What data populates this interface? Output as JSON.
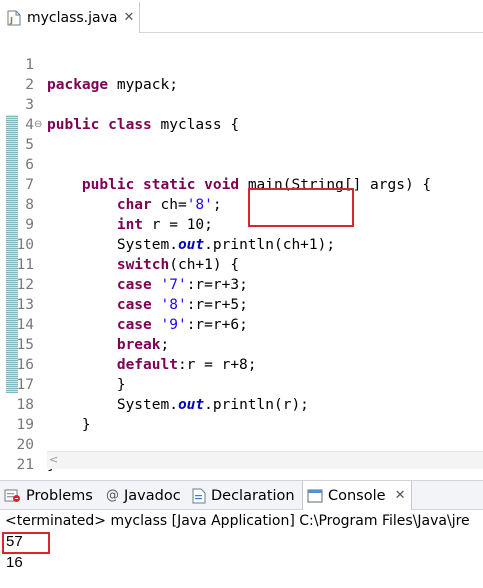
{
  "editor_tab": {
    "filename": "myclass.java",
    "close_glyph": "✕",
    "icon": "java-file-icon"
  },
  "code": {
    "lines": [
      {
        "num": "1",
        "text": "package mypack;"
      },
      {
        "num": "2",
        "text": ""
      },
      {
        "num": "3",
        "text": "public class myclass {"
      },
      {
        "num": "4",
        "text": ""
      },
      {
        "num": "5",
        "text": "public static void main(String[] args) {",
        "fold": "⊖"
      },
      {
        "num": "6",
        "text": ""
      },
      {
        "num": "7",
        "text": "char ch='8';"
      },
      {
        "num": "8",
        "text": "int r = 10;"
      },
      {
        "num": "9",
        "text": "System.out.println(ch+1);"
      },
      {
        "num": "10",
        "text": "switch(ch+1) {"
      },
      {
        "num": "11",
        "text": "case '7':r=r+3;"
      },
      {
        "num": "12",
        "text": "case '8':r=r+5;"
      },
      {
        "num": "13",
        "text": "case '9':r=r+6;"
      },
      {
        "num": "14",
        "text": "break;"
      },
      {
        "num": "15",
        "text": "default:r = r+8;"
      },
      {
        "num": "16",
        "text": "}"
      },
      {
        "num": "17",
        "text": "System.out.println(r);"
      },
      {
        "num": "18",
        "text": "}"
      },
      {
        "num": "19",
        "text": ""
      },
      {
        "num": "20",
        "text": "}"
      },
      {
        "num": "21",
        "text": ""
      }
    ]
  },
  "panel": {
    "tabs": [
      {
        "label": "Problems",
        "icon": "problems-icon"
      },
      {
        "label": "Javadoc",
        "icon": "javadoc-at-icon"
      },
      {
        "label": "Declaration",
        "icon": "declaration-icon"
      },
      {
        "label": "Console",
        "icon": "console-icon",
        "active": true,
        "close_glyph": "✕"
      }
    ]
  },
  "console": {
    "status": "<terminated> myclass [Java Application] C:\\Program Files\\Java\\jre",
    "output": [
      "57",
      "16"
    ]
  },
  "colors": {
    "keyword": "#7f0055",
    "string": "#2a00ff",
    "static_field": "#0000c0",
    "highlight_border": "#d9262e",
    "change_bar": "#7fb9bd"
  }
}
